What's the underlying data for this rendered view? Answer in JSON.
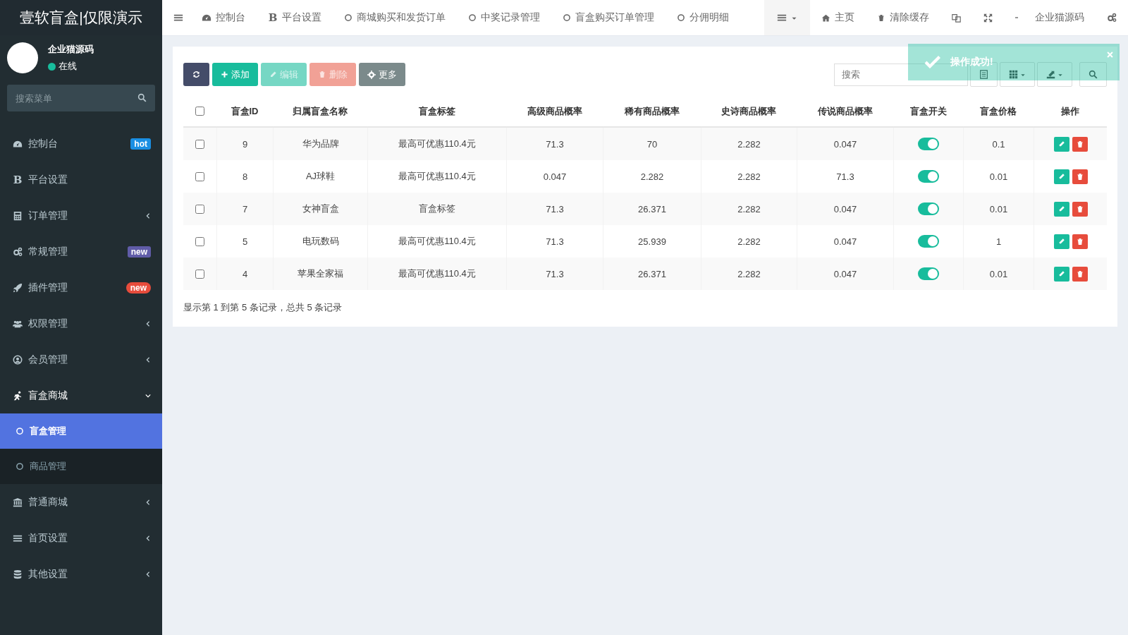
{
  "sidebar": {
    "logo": "壹软盲盒|仅限演示",
    "user": {
      "name": "企业猫源码",
      "status": "在线"
    },
    "search": {
      "placeholder": "搜索菜单"
    },
    "items": [
      {
        "label": "控制台",
        "badge": {
          "text": "hot",
          "color": "#1a8fe3",
          "pill": false
        }
      },
      {
        "label": "平台设置",
        "icon_text": "B"
      },
      {
        "label": "订单管理",
        "expanded": false
      },
      {
        "label": "常规管理",
        "badge": {
          "text": "new",
          "color": "#605ca8",
          "pill": false
        }
      },
      {
        "label": "插件管理",
        "badge": {
          "text": "new",
          "color": "#e74c3c",
          "pill": true
        }
      },
      {
        "label": "权限管理",
        "expanded": false
      },
      {
        "label": "会员管理",
        "expanded": false
      },
      {
        "label": "盲盒商城",
        "expanded": true,
        "children": [
          {
            "label": "盲盒管理",
            "selected": true
          },
          {
            "label": "商品管理",
            "selected": false
          }
        ]
      },
      {
        "label": "普通商城",
        "expanded": false
      },
      {
        "label": "首页设置",
        "expanded": false
      },
      {
        "label": "其他设置",
        "expanded": false
      }
    ]
  },
  "top_nav": {
    "tabs": [
      {
        "label": "控制台",
        "kind": "dashboard"
      },
      {
        "label": "平台设置",
        "kind": "glyph",
        "icon_text": "B"
      },
      {
        "label": "商城购买和发货订单",
        "kind": "circle"
      },
      {
        "label": "中奖记录管理",
        "kind": "circle"
      },
      {
        "label": "盲盒购买订单管理",
        "kind": "circle"
      },
      {
        "label": "分佣明细",
        "kind": "circle"
      }
    ],
    "right": [
      {
        "label": "主页",
        "kind": "home"
      },
      {
        "label": "清除缓存",
        "kind": "trash"
      }
    ],
    "user": "企业猫源码"
  },
  "toolbar": {
    "buttons": [
      {
        "kind": "refresh",
        "color": "#444c69",
        "disabled": false
      },
      {
        "kind": "add",
        "label": "添加",
        "color": "#18bc9c",
        "disabled": false
      },
      {
        "kind": "edit",
        "label": "编辑",
        "color": "#76d7c4",
        "disabled": true
      },
      {
        "kind": "delete",
        "label": "删除",
        "color": "#f1a196",
        "disabled": true
      },
      {
        "kind": "more",
        "label": "更多",
        "color": "#7b8a8b",
        "disabled": false
      }
    ],
    "search": {
      "placeholder": "搜索"
    }
  },
  "toast": {
    "text": "操作成功!"
  },
  "table": {
    "header_checked": false,
    "columns": [
      "盲盒ID",
      "归属盲盒名称",
      "盲盒标签",
      "高级商品概率",
      "稀有商品概率",
      "史诗商品概率",
      "传说商品概率",
      "盲盒开关",
      "盲盒价格",
      "操作"
    ],
    "rows": [
      {
        "checked": false,
        "cells": [
          "9",
          "华为品牌",
          "最高可优惠110.4元",
          "71.3",
          "70",
          "2.282",
          "0.047"
        ],
        "on": true,
        "price": "0.1"
      },
      {
        "checked": false,
        "cells": [
          "8",
          "AJ球鞋",
          "最高可优惠110.4元",
          "0.047",
          "2.282",
          "2.282",
          "71.3"
        ],
        "on": true,
        "price": "0.01"
      },
      {
        "checked": false,
        "cells": [
          "7",
          "女神盲盒",
          "盲盒标签",
          "71.3",
          "26.371",
          "2.282",
          "0.047"
        ],
        "on": true,
        "price": "0.01"
      },
      {
        "checked": false,
        "cells": [
          "5",
          "电玩数码",
          "最高可优惠110.4元",
          "71.3",
          "25.939",
          "2.282",
          "0.047"
        ],
        "on": true,
        "price": "1"
      },
      {
        "checked": false,
        "cells": [
          "4",
          "苹果全家福",
          "最高可优惠110.4元",
          "71.3",
          "26.371",
          "2.282",
          "0.047"
        ],
        "on": true,
        "price": "0.01"
      }
    ]
  },
  "pagination": {
    "summary": "显示第 1 到第 5 条记录，总共 5 条记录"
  }
}
